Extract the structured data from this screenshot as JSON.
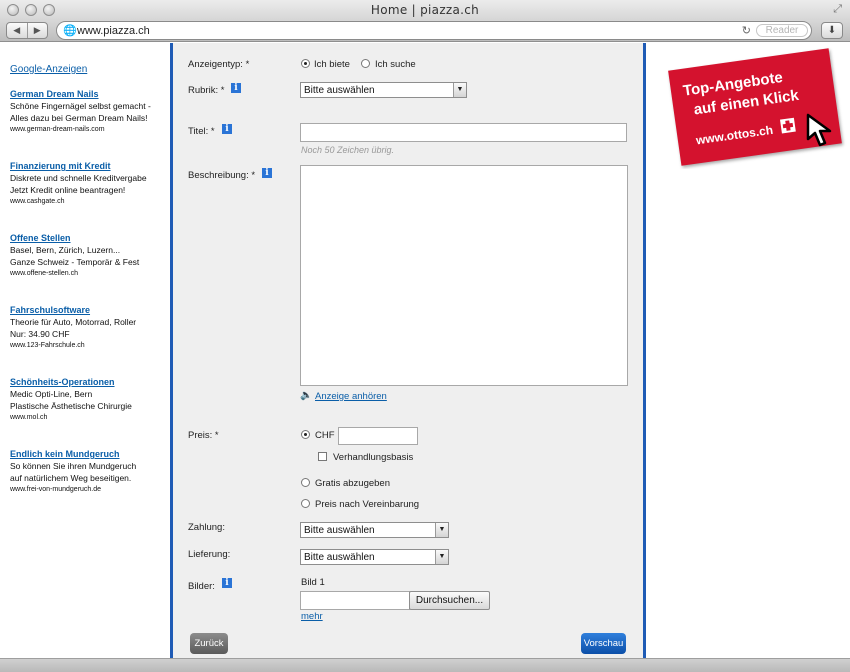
{
  "browser": {
    "title": "Home | piazza.ch",
    "url": "www.piazza.ch",
    "reader_label": "Reader"
  },
  "ads": {
    "title": "Google-Anzeigen",
    "items": [
      {
        "heading": "German Dream Nails",
        "line1": "Schöne Fingernägel selbst gemacht -",
        "line2": "Alles dazu bei German Dream Nails!",
        "url": "www.german-dream-nails.com"
      },
      {
        "heading": "Finanzierung mit Kredit",
        "line1": "Diskrete und schnelle Kreditvergabe",
        "line2": "Jetzt Kredit online beantragen!",
        "url": "www.cashgate.ch"
      },
      {
        "heading": "Offene Stellen",
        "line1": "Basel, Bern, Zürich, Luzern...",
        "line2": "Ganze Schweiz - Temporär & Fest",
        "url": "www.offene-stellen.ch"
      },
      {
        "heading": "Fahrschulsoftware",
        "line1": "Theorie für Auto, Motorrad, Roller",
        "line2": "Nur: 34.90 CHF",
        "url": "www.123-Fahrschule.ch"
      },
      {
        "heading": "Schönheits-Operationen",
        "line1": "Medic Opti-Line, Bern",
        "line2": "Plastische Ästhetische Chirurgie",
        "url": "www.mol.ch"
      },
      {
        "heading": "Endlich kein Mundgeruch",
        "line1": "So können Sie ihren Mundgeruch",
        "line2": "auf natürlichem Weg beseitigen.",
        "url": "www.frei-von-mundgeruch.de"
      }
    ]
  },
  "form": {
    "anzeigentyp_label": "Anzeigentyp: *",
    "anzeigentyp_options": [
      "Ich biete",
      "Ich suche"
    ],
    "rubrik_label": "Rubrik: *",
    "rubrik_value": "Bitte auswählen",
    "titel_label": "Titel: *",
    "titel_value": "",
    "titel_hint": "Noch  50 Zeichen übrig.",
    "beschreibung_label": "Beschreibung: *",
    "beschreibung_value": "",
    "anhoeren_link": "Anzeige anhören",
    "preis_label": "Preis: *",
    "preis_currency": "CHF",
    "preis_value": "",
    "verhandlungsbasis_label": "Verhandlungsbasis",
    "gratis_label": "Gratis abzugeben",
    "vereinbarung_label": "Preis nach Vereinbarung",
    "zahlung_label": "Zahlung:",
    "zahlung_value": "Bitte auswählen",
    "lieferung_label": "Lieferung:",
    "lieferung_value": "Bitte auswählen",
    "bilder_label": "Bilder:",
    "bild1_label": "Bild 1",
    "browse_label": "Durchsuchen...",
    "mehr_link": "mehr",
    "back_button": "Zurück",
    "preview_button": "Vorschau"
  },
  "banner": {
    "line1": "Top-Angebote",
    "line2": "auf einen Klick",
    "line3": "www.ottos.ch"
  },
  "colors": {
    "accent_blue": "#1f5bb5",
    "link_blue": "#0a5ea8",
    "banner_red": "#d4122e",
    "form_bg": "#efefef"
  }
}
